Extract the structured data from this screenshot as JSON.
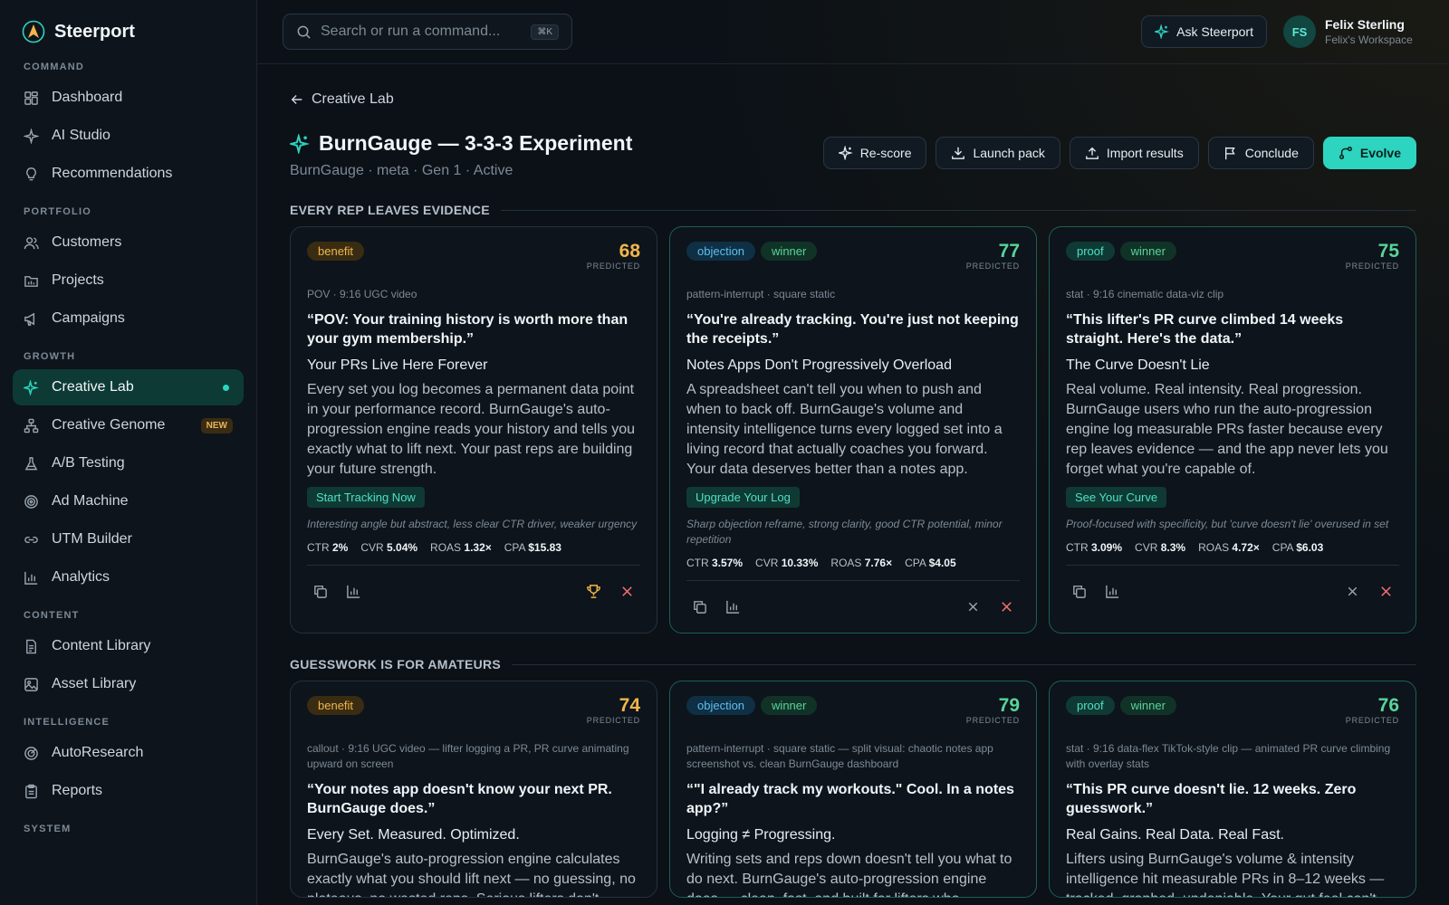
{
  "brand": {
    "name": "Steerport"
  },
  "sidebar": {
    "sections": [
      {
        "label": "COMMAND",
        "items": [
          {
            "label": "Dashboard"
          },
          {
            "label": "AI Studio"
          },
          {
            "label": "Recommendations"
          }
        ]
      },
      {
        "label": "PORTFOLIO",
        "items": [
          {
            "label": "Customers"
          },
          {
            "label": "Projects"
          },
          {
            "label": "Campaigns"
          }
        ]
      },
      {
        "label": "GROWTH",
        "items": [
          {
            "label": "Creative Lab"
          },
          {
            "label": "Creative Genome",
            "badge": "NEW"
          },
          {
            "label": "A/B Testing"
          },
          {
            "label": "Ad Machine"
          },
          {
            "label": "UTM Builder"
          },
          {
            "label": "Analytics"
          }
        ]
      },
      {
        "label": "CONTENT",
        "items": [
          {
            "label": "Content Library"
          },
          {
            "label": "Asset Library"
          }
        ]
      },
      {
        "label": "INTELLIGENCE",
        "items": [
          {
            "label": "AutoResearch"
          },
          {
            "label": "Reports"
          }
        ]
      },
      {
        "label": "SYSTEM",
        "items": []
      }
    ]
  },
  "topbar": {
    "search_placeholder": "Search or run a command...",
    "shortcut": "⌘K",
    "ask_label": "Ask Steerport",
    "user_name": "Felix Sterling",
    "user_workspace": "Felix's Workspace",
    "avatar_initials": "FS"
  },
  "page": {
    "breadcrumb": "Creative Lab",
    "title": "BurnGauge — 3-3-3 Experiment",
    "subtitle": "BurnGauge · meta · Gen 1 · Active",
    "actions": {
      "rescore": "Re-score",
      "launch": "Launch pack",
      "import": "Import results",
      "conclude": "Conclude",
      "evolve": "Evolve"
    }
  },
  "sections": [
    {
      "title": "EVERY REP LEAVES EVIDENCE",
      "cards": [
        {
          "tags": [
            "benefit"
          ],
          "score": "68",
          "score_label": "PREDICTED",
          "format": "POV · 9:16 UGC video",
          "hook": "“POV: Your training history is worth more than your gym membership.”",
          "headline": "Your PRs Live Here Forever",
          "body": "Every set you log becomes a permanent data point in your performance record. BurnGauge's auto-progression engine reads your history and tells you exactly what to lift next. Your past reps are building your future strength.",
          "cta": "Start Tracking Now",
          "note": "Interesting angle but abstract, less clear CTR driver, weaker urgency",
          "metrics": {
            "ctr": "2%",
            "cvr": "5.04%",
            "roas": "1.32×",
            "cpa": "$15.83"
          }
        },
        {
          "tags": [
            "objection",
            "winner"
          ],
          "score": "77",
          "score_label": "PREDICTED",
          "format": "pattern-interrupt · square static",
          "hook": "“You're already tracking. You're just not keeping the receipts.”",
          "headline": "Notes Apps Don't Progressively Overload",
          "body": "A spreadsheet can't tell you when to push and when to back off. BurnGauge's volume and intensity intelligence turns every logged set into a living record that actually coaches you forward. Your data deserves better than a notes app.",
          "cta": "Upgrade Your Log",
          "note": "Sharp objection reframe, strong clarity, good CTR potential, minor repetition",
          "metrics": {
            "ctr": "3.57%",
            "cvr": "10.33%",
            "roas": "7.76×",
            "cpa": "$4.05"
          }
        },
        {
          "tags": [
            "proof",
            "winner"
          ],
          "score": "75",
          "score_label": "PREDICTED",
          "format": "stat · 9:16 cinematic data-viz clip",
          "hook": "“This lifter's PR curve climbed 14 weeks straight. Here's the data.”",
          "headline": "The Curve Doesn't Lie",
          "body": "Real volume. Real intensity. Real progression. BurnGauge users who run the auto-progression engine log measurable PRs faster because every rep leaves evidence — and the app never lets you forget what you're capable of.",
          "cta": "See Your Curve",
          "note": "Proof-focused with specificity, but 'curve doesn't lie' overused in set",
          "metrics": {
            "ctr": "3.09%",
            "cvr": "8.3%",
            "roas": "4.72×",
            "cpa": "$6.03"
          }
        }
      ]
    },
    {
      "title": "GUESSWORK IS FOR AMATEURS",
      "cards": [
        {
          "tags": [
            "benefit"
          ],
          "score": "74",
          "score_label": "PREDICTED",
          "format": "callout · 9:16 UGC video — lifter logging a PR, PR curve animating upward on screen",
          "hook": "“Your notes app doesn't know your next PR. BurnGauge does.”",
          "headline": "Every Set. Measured. Optimized.",
          "body": "BurnGauge's auto-progression engine calculates exactly what you should lift next — no guessing, no plateaus, no wasted reps. Serious lifters don't"
        },
        {
          "tags": [
            "objection",
            "winner"
          ],
          "score": "79",
          "score_label": "PREDICTED",
          "format": "pattern-interrupt · square static — split visual: chaotic notes app screenshot vs. clean BurnGauge dashboard",
          "hook": "“\"I already track my workouts.\" Cool. In a notes app?”",
          "headline": "Logging ≠ Progressing.",
          "body": "Writing sets and reps down doesn't tell you what to do next. BurnGauge's auto-progression engine does — clean, fast, and built for lifters who"
        },
        {
          "tags": [
            "proof",
            "winner"
          ],
          "score": "76",
          "score_label": "PREDICTED",
          "format": "stat · 9:16 data-flex TikTok-style clip — animated PR curve climbing with overlay stats",
          "hook": "“This PR curve doesn't lie. 12 weeks. Zero guesswork.”",
          "headline": "Real Gains. Real Data. Real Fast.",
          "body": "Lifters using BurnGauge's volume & intensity intelligence hit measurable PRs in 8–12 weeks — tracked, graphed, undeniable. Your gut feel can't"
        }
      ]
    }
  ]
}
